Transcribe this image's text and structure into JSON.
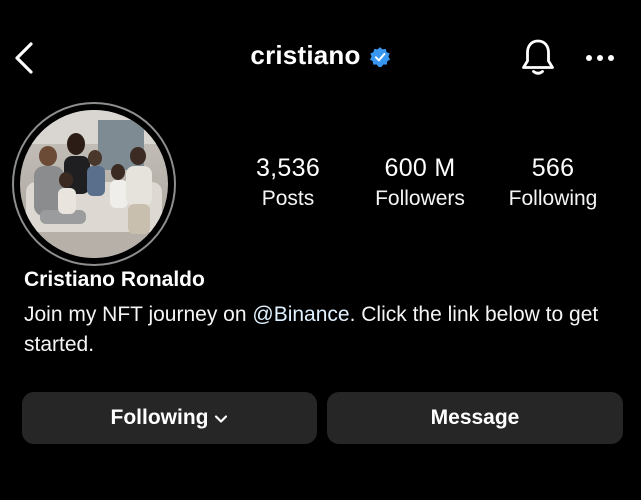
{
  "header": {
    "username": "cristiano",
    "icons": {
      "back": "back-arrow-icon",
      "verified": "verified-badge-icon",
      "notifications": "bell-icon",
      "more": "more-options-icon"
    }
  },
  "profile": {
    "avatar": "family-photo-avatar",
    "display_name": "Cristiano Ronaldo",
    "bio": {
      "before": "Join my NFT journey on ",
      "mention": "@Binance",
      "after": ". Click the link below to get started."
    }
  },
  "stats": [
    {
      "value": "3,536",
      "label": "Posts"
    },
    {
      "value": "600 M",
      "label": "Followers"
    },
    {
      "value": "566",
      "label": "Following"
    }
  ],
  "actions": {
    "following_label": "Following",
    "message_label": "Message"
  },
  "colors": {
    "background": "#000000",
    "button_bg": "#262626",
    "verified_blue": "#3897F0",
    "mention": "#E0F1FF"
  }
}
